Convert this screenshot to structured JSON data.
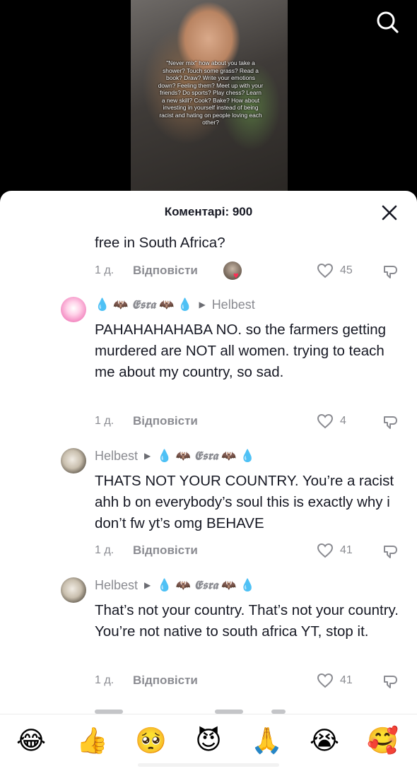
{
  "video": {
    "overlay_text": "\"Never mix\" how about you take a shower? Touch some grass? Read a book? Draw? Write your emotions down? Feeling them? Meet up with your friends? Do sports? Play chess? Learn a new skill? Cook? Bake? How about investing in yourself instead of being racist and hating on people loving each other?",
    "search_icon": "search-icon"
  },
  "sheet": {
    "title": "Коментарі: 900",
    "close_icon": "close-icon"
  },
  "comments": [
    {
      "text": "free in South Africa?",
      "time": "1 д.",
      "reply": "Відповісти",
      "likes": "45",
      "liked_by_creator": true
    },
    {
      "author": "𝕰𝖘𝖗𝖆",
      "reply_to": "Helbest",
      "text": "PAHAHAHAHABA NO. so the farmers getting murdered are NOT all women. trying to teach me about my country, so sad.",
      "time": "1 д.",
      "reply": "Відповісти",
      "likes": "4"
    },
    {
      "author": "Helbest",
      "reply_to": "𝕰𝖘𝖗𝖆",
      "text": "THATS NOT YOUR COUNTRY. You’re a racist ahh b on everybody’s soul this is exactly why i don’t fw yt’s omg BEHAVE",
      "time": "1 д.",
      "reply": "Відповісти",
      "likes": "41"
    },
    {
      "author": "Helbest",
      "reply_to": "𝕰𝖘𝖗𝖆",
      "text": "That’s not your country. That’s not your country. You’re not native to south africa YT, stop it.",
      "time": "1 д.",
      "reply": "Відповісти",
      "likes": "41"
    }
  ],
  "emoji_bar": [
    "😂",
    "👍",
    "🥺",
    "😈",
    "🙏",
    "😭",
    "🥰"
  ]
}
